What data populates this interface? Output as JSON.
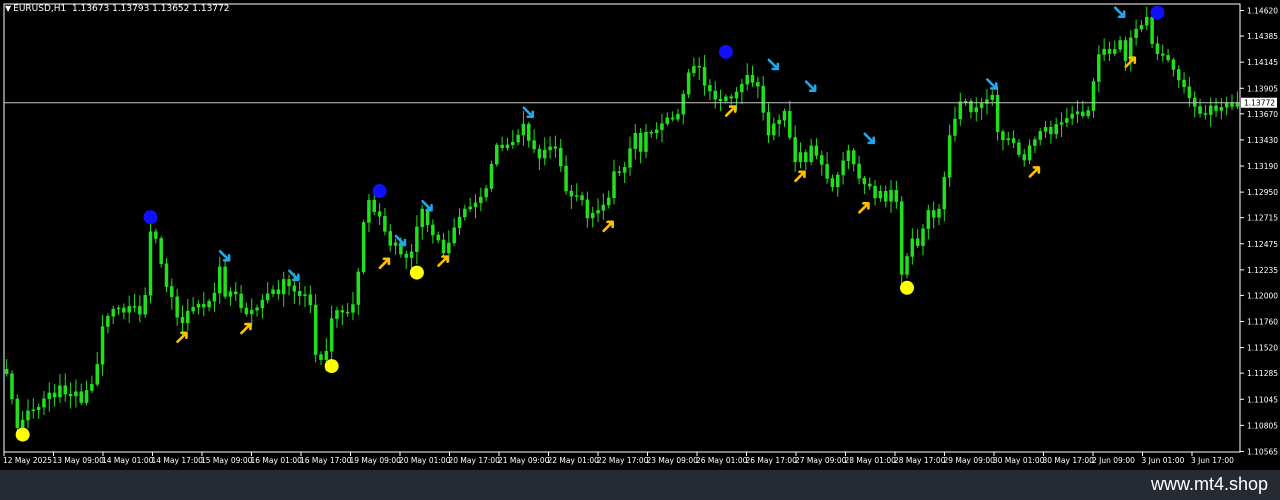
{
  "header": {
    "symbol": "EURUSD,H1",
    "ohlc": "1.13673 1.13793 1.13652 1.13772"
  },
  "footer": {
    "site": "www.mt4.shop"
  },
  "colors": {
    "background": "#000000",
    "candle": "#22e01e",
    "axis": "#ffffff",
    "price_line": "#c8c8c8",
    "arrow_up": "#ffc000",
    "arrow_down": "#1fa9ea",
    "dot_high": "#1010ff",
    "dot_low": "#ffff00",
    "footer": "#262a33"
  },
  "chart_data": {
    "type": "candlestick",
    "symbol": "EURUSD",
    "timeframe": "H1",
    "ylim": [
      1.1056,
      1.1468
    ],
    "y_ticks": [
      "1.14620",
      "1.14385",
      "1.14145",
      "1.13905",
      "1.13670",
      "1.13430",
      "1.13190",
      "1.12950",
      "1.12715",
      "1.12475",
      "1.12235",
      "1.12000",
      "1.11760",
      "1.11520",
      "1.11285",
      "1.11045",
      "1.10805",
      "1.10565"
    ],
    "current_price": "1.13772",
    "x_ticks": [
      "12 May 2025",
      "13 May 09:00",
      "14 May 01:00",
      "14 May 17:00",
      "15 May 09:00",
      "16 May 01:00",
      "16 May 17:00",
      "19 May 09:00",
      "20 May 01:00",
      "20 May 17:00",
      "21 May 09:00",
      "22 May 01:00",
      "22 May 17:00",
      "23 May 09:00",
      "26 May 01:00",
      "26 May 17:00",
      "27 May 09:00",
      "28 May 01:00",
      "28 May 17:00",
      "29 May 09:00",
      "30 May 01:00",
      "30 May 17:00",
      "2 Jun 09:00",
      "3 Jun 01:00",
      "3 Jun 17:00"
    ],
    "close_path": [
      [
        0,
        1.1128
      ],
      [
        2,
        1.108
      ],
      [
        4,
        1.109
      ],
      [
        6,
        1.1097
      ],
      [
        8,
        1.1107
      ],
      [
        10,
        1.1113
      ],
      [
        12,
        1.111
      ],
      [
        14,
        1.1105
      ],
      [
        16,
        1.1122
      ],
      [
        17,
        1.114
      ],
      [
        18,
        1.117
      ],
      [
        20,
        1.1185
      ],
      [
        22,
        1.1188
      ],
      [
        24,
        1.119
      ],
      [
        25,
        1.1185
      ],
      [
        26,
        1.1197
      ],
      [
        27,
        1.1262
      ],
      [
        28,
        1.125
      ],
      [
        29,
        1.1232
      ],
      [
        30,
        1.1212
      ],
      [
        31,
        1.1197
      ],
      [
        32,
        1.1178
      ],
      [
        33,
        1.1172
      ],
      [
        34,
        1.1183
      ],
      [
        36,
        1.119
      ],
      [
        38,
        1.1196
      ],
      [
        39,
        1.1205
      ],
      [
        40,
        1.1225
      ],
      [
        41,
        1.12
      ],
      [
        42,
        1.1205
      ],
      [
        43,
        1.1199
      ],
      [
        44,
        1.119
      ],
      [
        45,
        1.118
      ],
      [
        46,
        1.1186
      ],
      [
        48,
        1.1196
      ],
      [
        50,
        1.1206
      ],
      [
        51,
        1.1203
      ],
      [
        52,
        1.1212
      ],
      [
        53,
        1.1208
      ],
      [
        54,
        1.1205
      ],
      [
        55,
        1.1198
      ],
      [
        56,
        1.12
      ],
      [
        57,
        1.1192
      ],
      [
        58,
        1.1145
      ],
      [
        59,
        1.1143
      ],
      [
        60,
        1.1152
      ],
      [
        61,
        1.1178
      ],
      [
        62,
        1.1186
      ],
      [
        63,
        1.1185
      ],
      [
        64,
        1.1186
      ],
      [
        65,
        1.1192
      ],
      [
        66,
        1.1225
      ],
      [
        67,
        1.1265
      ],
      [
        68,
        1.129
      ],
      [
        69,
        1.128
      ],
      [
        70,
        1.127
      ],
      [
        71,
        1.1258
      ],
      [
        72,
        1.1245
      ],
      [
        73,
        1.1245
      ],
      [
        74,
        1.124
      ],
      [
        75,
        1.1235
      ],
      [
        76,
        1.1241
      ],
      [
        77,
        1.1262
      ],
      [
        78,
        1.1278
      ],
      [
        79,
        1.1267
      ],
      [
        80,
        1.1258
      ],
      [
        81,
        1.125
      ],
      [
        82,
        1.1243
      ],
      [
        83,
        1.125
      ],
      [
        84,
        1.126
      ],
      [
        85,
        1.127
      ],
      [
        86,
        1.128
      ],
      [
        88,
        1.1285
      ],
      [
        90,
        1.13
      ],
      [
        91,
        1.1318
      ],
      [
        92,
        1.134
      ],
      [
        93,
        1.1335
      ],
      [
        94,
        1.1342
      ],
      [
        95,
        1.1338
      ],
      [
        96,
        1.1346
      ],
      [
        97,
        1.1358
      ],
      [
        98,
        1.1345
      ],
      [
        99,
        1.1332
      ],
      [
        100,
        1.1328
      ],
      [
        101,
        1.1336
      ],
      [
        102,
        1.1337
      ],
      [
        103,
        1.1333
      ],
      [
        104,
        1.132
      ],
      [
        105,
        1.13
      ],
      [
        106,
        1.1292
      ],
      [
        107,
        1.1295
      ],
      [
        108,
        1.1284
      ],
      [
        109,
        1.1273
      ],
      [
        110,
        1.1275
      ],
      [
        112,
        1.128
      ],
      [
        113,
        1.1288
      ],
      [
        114,
        1.131
      ],
      [
        115,
        1.1315
      ],
      [
        116,
        1.132
      ],
      [
        117,
        1.1335
      ],
      [
        118,
        1.135
      ],
      [
        119,
        1.133
      ],
      [
        120,
        1.135
      ],
      [
        121,
        1.1346
      ],
      [
        122,
        1.135
      ],
      [
        123,
        1.1358
      ],
      [
        124,
        1.136
      ],
      [
        125,
        1.1363
      ],
      [
        126,
        1.1366
      ],
      [
        127,
        1.1382
      ],
      [
        128,
        1.1405
      ],
      [
        129,
        1.1412
      ],
      [
        130,
        1.1408
      ],
      [
        131,
        1.139
      ],
      [
        132,
        1.1385
      ],
      [
        133,
        1.1383
      ],
      [
        134,
        1.1381
      ],
      [
        135,
        1.1384
      ],
      [
        136,
        1.1385
      ],
      [
        137,
        1.139
      ],
      [
        138,
        1.1393
      ],
      [
        139,
        1.14
      ],
      [
        140,
        1.1398
      ],
      [
        141,
        1.1392
      ],
      [
        142,
        1.137
      ],
      [
        143,
        1.135
      ],
      [
        144,
        1.1357
      ],
      [
        145,
        1.136
      ],
      [
        146,
        1.1366
      ],
      [
        147,
        1.1342
      ],
      [
        148,
        1.1325
      ],
      [
        149,
        1.133
      ],
      [
        150,
        1.1326
      ],
      [
        151,
        1.1335
      ],
      [
        152,
        1.133
      ],
      [
        153,
        1.1322
      ],
      [
        154,
        1.1306
      ],
      [
        155,
        1.1303
      ],
      [
        156,
        1.1308
      ],
      [
        157,
        1.1325
      ],
      [
        158,
        1.1335
      ],
      [
        159,
        1.132
      ],
      [
        160,
        1.1308
      ],
      [
        161,
        1.1302
      ],
      [
        162,
        1.1297
      ],
      [
        163,
        1.129
      ],
      [
        164,
        1.1292
      ],
      [
        165,
        1.129
      ],
      [
        166,
        1.1296
      ],
      [
        167,
        1.1285
      ],
      [
        168,
        1.1222
      ],
      [
        169,
        1.1235
      ],
      [
        170,
        1.125
      ],
      [
        171,
        1.1245
      ],
      [
        172,
        1.1265
      ],
      [
        173,
        1.1275
      ],
      [
        174,
        1.1272
      ],
      [
        175,
        1.128
      ],
      [
        176,
        1.1306
      ],
      [
        177,
        1.1345
      ],
      [
        178,
        1.1365
      ],
      [
        179,
        1.1375
      ],
      [
        180,
        1.138
      ],
      [
        181,
        1.1372
      ],
      [
        182,
        1.1375
      ],
      [
        183,
        1.138
      ],
      [
        184,
        1.1378
      ],
      [
        185,
        1.1382
      ],
      [
        186,
        1.135
      ],
      [
        187,
        1.1347
      ],
      [
        188,
        1.1345
      ],
      [
        189,
        1.1338
      ],
      [
        190,
        1.133
      ],
      [
        191,
        1.1327
      ],
      [
        192,
        1.134
      ],
      [
        193,
        1.1346
      ],
      [
        194,
        1.135
      ],
      [
        195,
        1.1354
      ],
      [
        196,
        1.135
      ],
      [
        197,
        1.1356
      ],
      [
        198,
        1.1362
      ],
      [
        199,
        1.136
      ],
      [
        200,
        1.137
      ],
      [
        201,
        1.1365
      ],
      [
        202,
        1.1368
      ],
      [
        203,
        1.1372
      ],
      [
        204,
        1.14
      ],
      [
        205,
        1.142
      ],
      [
        206,
        1.1427
      ],
      [
        207,
        1.1421
      ],
      [
        208,
        1.143
      ],
      [
        209,
        1.1438
      ],
      [
        210,
        1.142
      ],
      [
        211,
        1.144
      ],
      [
        212,
        1.1445
      ],
      [
        213,
        1.1452
      ],
      [
        214,
        1.1452
      ],
      [
        215,
        1.1433
      ],
      [
        216,
        1.1425
      ],
      [
        217,
        1.1423
      ],
      [
        218,
        1.1418
      ],
      [
        219,
        1.1408
      ],
      [
        220,
        1.1398
      ],
      [
        221,
        1.1388
      ],
      [
        222,
        1.138
      ],
      [
        223,
        1.1373
      ],
      [
        224,
        1.137
      ],
      [
        225,
        1.1368
      ],
      [
        226,
        1.1372
      ],
      [
        227,
        1.1368
      ],
      [
        228,
        1.1373
      ],
      [
        229,
        1.138
      ],
      [
        230,
        1.1372
      ],
      [
        231,
        1.1377
      ]
    ],
    "signals": {
      "down_arrows": [
        [
          41,
          1.1236
        ],
        [
          54,
          1.1218
        ],
        [
          74,
          1.125
        ],
        [
          79,
          1.1282
        ],
        [
          98,
          1.1368
        ],
        [
          144,
          1.1412
        ],
        [
          151,
          1.1392
        ],
        [
          162,
          1.1344
        ],
        [
          185,
          1.1394
        ],
        [
          209,
          1.146
        ]
      ],
      "up_arrows": [
        [
          33,
          1.1162
        ],
        [
          45,
          1.117
        ],
        [
          71,
          1.123
        ],
        [
          82,
          1.1232
        ],
        [
          113,
          1.1264
        ],
        [
          136,
          1.137
        ],
        [
          149,
          1.131
        ],
        [
          161,
          1.1281
        ],
        [
          193,
          1.1314
        ],
        [
          211,
          1.1415
        ]
      ],
      "high_dots": [
        [
          27,
          1.1272
        ],
        [
          70,
          1.1296
        ],
        [
          135,
          1.1424
        ],
        [
          216,
          1.146
        ]
      ],
      "low_dots": [
        [
          3,
          1.1072
        ],
        [
          61,
          1.1135
        ],
        [
          77,
          1.1221
        ],
        [
          169,
          1.1207
        ]
      ]
    }
  }
}
